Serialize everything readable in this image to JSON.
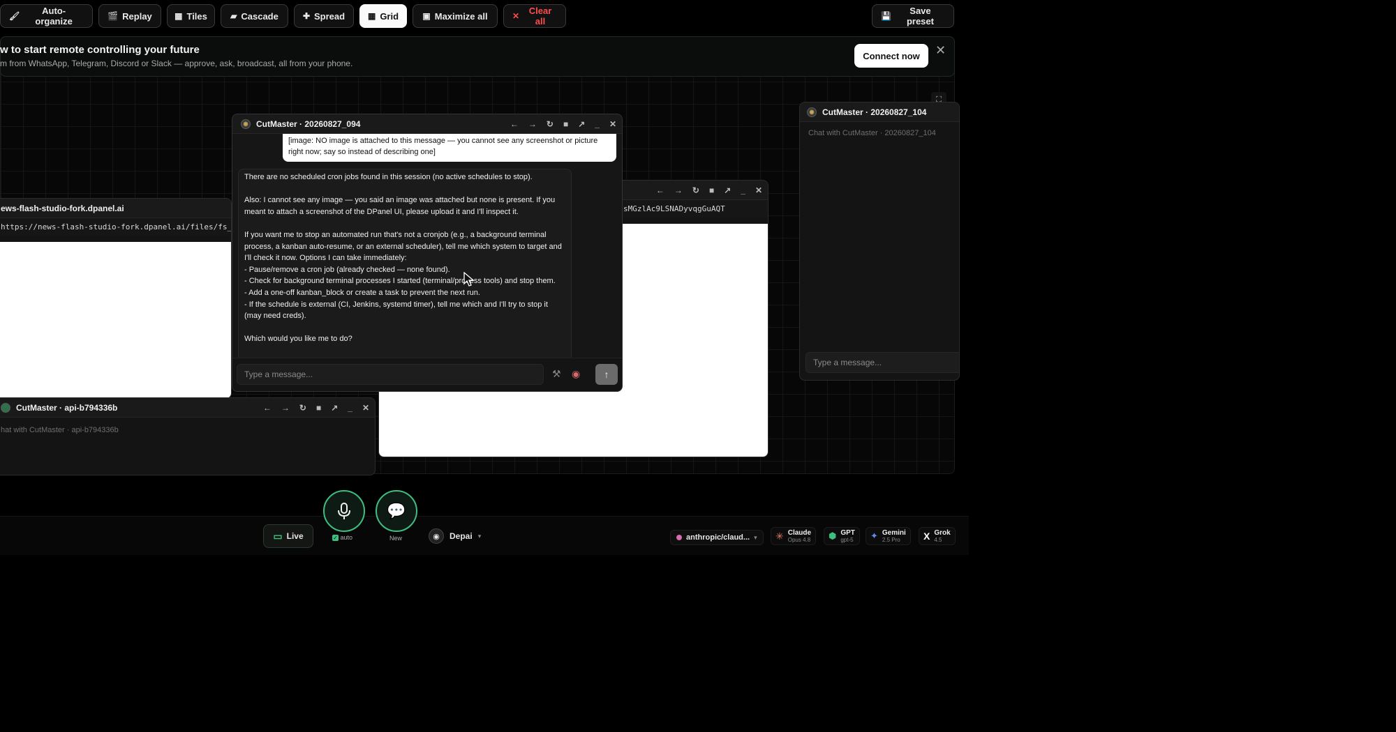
{
  "toolbar": {
    "buttons": [
      {
        "icon": "🖌",
        "label": "Auto-organize"
      },
      {
        "icon": "🎬",
        "label": "Replay"
      },
      {
        "icon": "▦",
        "label": "Tiles"
      },
      {
        "icon": "▰",
        "label": "Cascade"
      },
      {
        "icon": "✚",
        "label": "Spread"
      },
      {
        "icon": "▦",
        "label": "Grid"
      },
      {
        "icon": "▣",
        "label": "Maximize all"
      },
      {
        "icon": "✕",
        "label": "Clear all"
      }
    ],
    "save_preset": {
      "icon": "💾",
      "label": "Save preset"
    }
  },
  "banner": {
    "title": "w to start remote controlling your future",
    "subtitle": "m from WhatsApp, Telegram, Discord or Slack — approve, ask, broadcast, all from your phone.",
    "connect_label": "Connect now",
    "close_glyph": "✕"
  },
  "windows": {
    "browser_left": {
      "title": "ews-flash-studio-fork.dpanel.ai",
      "url": "https://news-flash-studio-fork.dpanel.ai/files/fs_qk"
    },
    "browser_right": {
      "url": "sMGzlAc9LSNADyvqgGuAQT"
    },
    "chat_main": {
      "title": "CutMaster · 20260827_094",
      "user_message": "[image: NO image is attached to this message — you cannot see any screenshot or picture right now; say so instead of describing one]",
      "assistant_message": "There are no scheduled cron jobs found in this session (no active schedules to stop).\n\nAlso: I cannot see any image — you said an image was attached but none is present. If you meant to attach a screenshot of the DPanel UI, please upload it and I'll inspect it.\n\nIf you want me to stop an automated run that's not a cronjob (e.g., a background terminal process, a kanban auto-resume, or an external scheduler), tell me which system to target and I'll check it now. Options I can take immediately:\n- Pause/remove a cron job (already checked — none found).\n- Check for background terminal processes I started (terminal/process tools) and stop them.\n- Add a one-off kanban_block or create a task to prevent the next run.\n- If the schedule is external (CI, Jenkins, systemd timer), tell me which and I'll try to stop it (may need creds).\n\nWhich would you like me to do?",
      "input_placeholder": "Type a message..."
    },
    "chat_bottom": {
      "title": "CutMaster · api-b794336b",
      "placeholder": "hat with CutMaster · api-b794336b"
    },
    "chat_right": {
      "title": "CutMaster · 20260827_104",
      "placeholder": "Chat with CutMaster · 20260827_104",
      "input_placeholder": "Type a message..."
    }
  },
  "window_controls": [
    "←",
    "→",
    "↻",
    "■",
    "↗",
    "_",
    "✕"
  ],
  "bottom_bar": {
    "live_label": "Live",
    "mic_label": "auto",
    "new_label": "New",
    "agent_name": "Depai",
    "model_selector": "anthropic/claud...",
    "models": [
      {
        "name": "Claude",
        "sub": "Opus 4.8",
        "icon": "✳",
        "color": "#e07a5f"
      },
      {
        "name": "GPT",
        "sub": "gpt-5",
        "icon": "⬢",
        "color": "#3fbf7f"
      },
      {
        "name": "Gemini",
        "sub": "2.5 Pro",
        "icon": "✦",
        "color": "#5b8def"
      },
      {
        "name": "Grok",
        "sub": "4.5",
        "icon": "X",
        "color": "#ffffff"
      }
    ]
  }
}
